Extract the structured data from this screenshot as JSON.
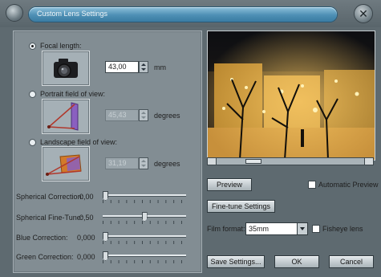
{
  "window": {
    "title": "Custom Lens Settings",
    "close_glyph": "✕"
  },
  "fov": {
    "focal_length": {
      "label": "Focal length:",
      "value": "43,00",
      "unit": "mm",
      "selected": true
    },
    "portrait": {
      "label": "Portrait field of view:",
      "value": "45,43",
      "unit": "degrees",
      "selected": false
    },
    "landscape": {
      "label": "Landscape field of view:",
      "value": "31,19",
      "unit": "degrees",
      "selected": false
    }
  },
  "sliders": {
    "spherical_correction": {
      "label": "Spherical Correction:",
      "value": "0,00",
      "level": 0.0
    },
    "spherical_fine_tune": {
      "label": "Spherical Fine-Tune:",
      "value": "0,50",
      "level": 0.5
    },
    "blue_correction": {
      "label": "Blue Correction:",
      "value": "0,000",
      "level": 0.0
    },
    "green_correction": {
      "label": "Green Correction:",
      "value": "0,000",
      "level": 0.0
    }
  },
  "preview": {
    "button": "Preview",
    "automatic_label": "Automatic Preview",
    "automatic_checked": false,
    "scroll_position": 0.22
  },
  "fine_tune_button": "Fine-tune Settings",
  "film": {
    "label": "Film format:",
    "value": "35mm",
    "fisheye_label": "Fisheye lens",
    "fisheye_checked": false
  },
  "buttons": {
    "save": "Save Settings...",
    "ok": "OK",
    "cancel": "Cancel"
  },
  "icons": {
    "camera": "camera-icon",
    "portrait": "portrait-fov-icon",
    "landscape": "landscape-fov-icon"
  }
}
